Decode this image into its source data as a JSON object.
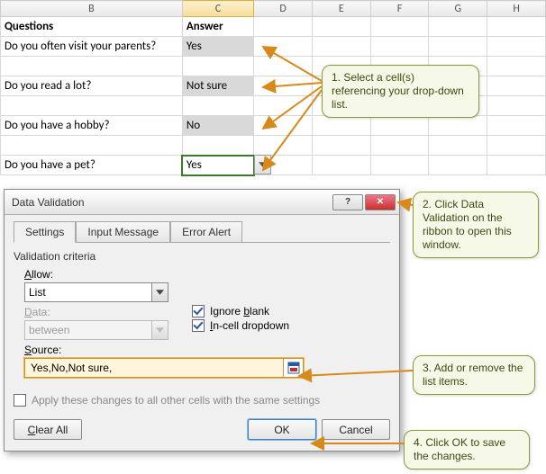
{
  "grid": {
    "columns": [
      "B",
      "C",
      "D",
      "E",
      "F",
      "G",
      "H"
    ],
    "active_column": "C",
    "header_questions": "Questions",
    "header_answer": "Answer",
    "rows": [
      {
        "q": "Do you often visit your parents?",
        "a": "Yes"
      },
      {
        "q": "Do you read a lot?",
        "a": "Not sure"
      },
      {
        "q": "Do you have a hobby?",
        "a": "No"
      },
      {
        "q": "Do you have a pet?",
        "a": "Yes"
      }
    ]
  },
  "dialog": {
    "title": "Data Validation",
    "tabs": {
      "settings": "Settings",
      "input_message": "Input Message",
      "error_alert": "Error Alert"
    },
    "group_label": "Validation criteria",
    "allow_label": "Allow:",
    "allow_value": "List",
    "data_label": "Data:",
    "data_value": "between",
    "ignore_blank": "Ignore blank",
    "in_cell_dropdown": "In-cell dropdown",
    "source_label": "Source:",
    "source_value": "Yes,No,Not sure,",
    "apply_changes": "Apply these changes to all other cells with the same settings",
    "clear_all": "Clear All",
    "ok": "OK",
    "cancel": "Cancel",
    "help_glyph": "?",
    "close_glyph": "✕"
  },
  "callouts": {
    "c1": "1. Select a cell(s)  referencing your drop-down list.",
    "c2": "2. Click Data Validation on the ribbon to open this window.",
    "c3": "3. Add or remove the list items.",
    "c4": "4. Click OK to save the changes."
  }
}
